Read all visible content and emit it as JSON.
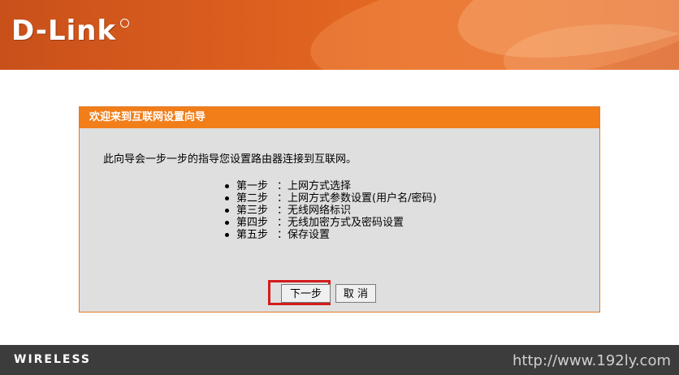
{
  "header": {
    "logo_text": "D-Link",
    "brand_color": "#e36b26"
  },
  "wizard": {
    "title": "欢迎来到互联网设置向导",
    "intro": "此向导会一步一步的指导您设置路由器连接到互联网。",
    "steps": [
      {
        "label": "第一步",
        "desc": "：上网方式选择"
      },
      {
        "label": "第二步",
        "desc": "：上网方式参数设置(用户名/密码)"
      },
      {
        "label": "第三步",
        "desc": "：无线网络标识"
      },
      {
        "label": "第四步",
        "desc": "：无线加密方式及密码设置"
      },
      {
        "label": "第五步",
        "desc": "：保存设置"
      }
    ],
    "next_label": "下一步",
    "cancel_label": "取 消",
    "title_bar_color": "#f27e1a",
    "highlight_color": "#d21c1c"
  },
  "footer": {
    "wireless_label": "WIRELESS",
    "watermark_url": "http://www.192ly.com"
  }
}
